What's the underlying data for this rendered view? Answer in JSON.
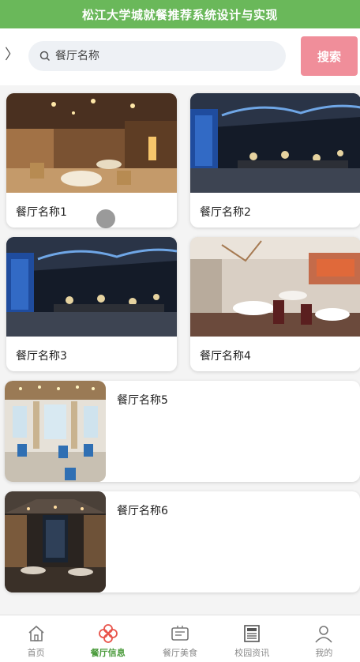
{
  "header": {
    "title": "松江大学城就餐推荐系统设计与实现"
  },
  "search": {
    "back_glyph": "〉",
    "placeholder": "餐厅名称",
    "button_label": "搜索"
  },
  "restaurants": [
    {
      "name": "餐厅名称1",
      "scene": "warm-hall"
    },
    {
      "name": "餐厅名称2",
      "scene": "blue-hall"
    },
    {
      "name": "餐厅名称3",
      "scene": "blue-hall"
    },
    {
      "name": "餐厅名称4",
      "scene": "red-hall"
    },
    {
      "name": "餐厅名称5",
      "scene": "bright-hall"
    },
    {
      "name": "餐厅名称6",
      "scene": "dark-hall"
    }
  ],
  "tabs": [
    {
      "label": "首页",
      "icon": "home-icon",
      "active": false
    },
    {
      "label": "餐厅信息",
      "icon": "flower-icon",
      "active": true
    },
    {
      "label": "餐厅美食",
      "icon": "menu-board-icon",
      "active": false
    },
    {
      "label": "校园资讯",
      "icon": "newspaper-icon",
      "active": false
    },
    {
      "label": "我的",
      "icon": "user-icon",
      "active": false
    }
  ],
  "colors": {
    "header": "#6ab85a",
    "search_button": "#f08e9a",
    "active_tab": "#4b9b3c",
    "active_icon": "#e8534a"
  }
}
